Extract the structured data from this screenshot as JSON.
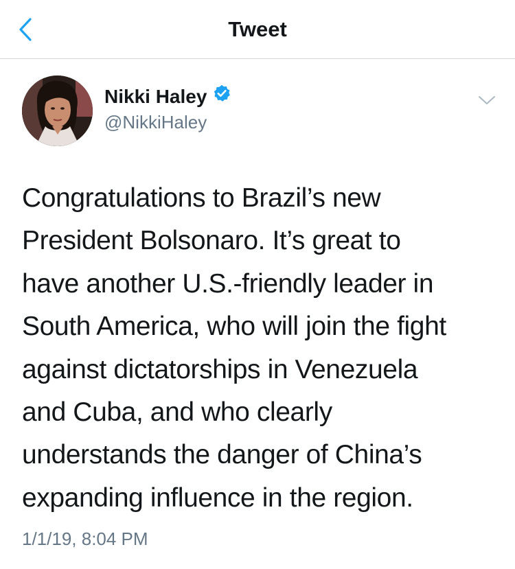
{
  "header": {
    "title": "Tweet",
    "back_icon": "chevron-left-icon",
    "accent_color": "#1da1f2"
  },
  "author": {
    "display_name": "Nikki Haley",
    "handle": "@NikkiHaley",
    "verified": true,
    "verified_icon": "verified-badge-icon",
    "verified_color": "#1da1f2"
  },
  "menu": {
    "icon": "chevron-down-icon"
  },
  "tweet": {
    "lines": [
      "Congratulations to Brazil’s new",
      "President Bolsonaro.  It’s great to",
      "have another U.S.-friendly leader in",
      "South America, who will join the fight",
      "against dictatorships in Venezuela",
      "and Cuba, and who clearly",
      "understands the danger of China’s",
      "expanding influence in the region."
    ],
    "timestamp": "1/1/19, 8:04 PM"
  }
}
